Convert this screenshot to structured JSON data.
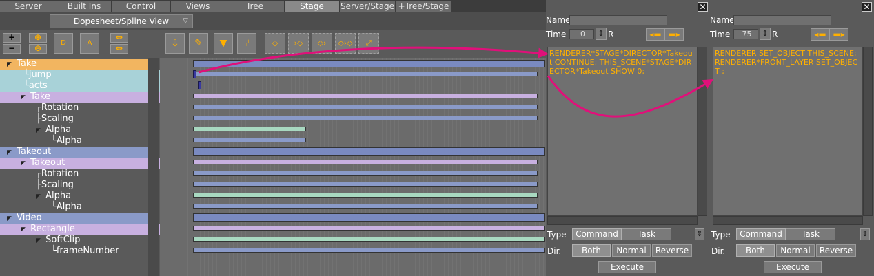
{
  "tabs": [
    "Server",
    "Built Ins",
    "Control",
    "Views",
    "Tree",
    "Stage",
    "Server/Stage",
    "+Tree/Stage"
  ],
  "active_tab": "Stage",
  "view_selector": "Dopesheet/Spline View",
  "toolbar": {
    "zoom_in": "+",
    "zoom_out": "−",
    "zoom_fit": "⊕",
    "zoom_sel": "⊖",
    "folder_d": "D",
    "folder_a": "A"
  },
  "tree": [
    {
      "label": "Take",
      "kind": "director"
    },
    {
      "label": "jump",
      "kind": "child"
    },
    {
      "label": "acts",
      "kind": "child"
    },
    {
      "label": "Take",
      "kind": "actor"
    },
    {
      "label": "Rotation",
      "kind": "channel"
    },
    {
      "label": "Scaling",
      "kind": "channel"
    },
    {
      "label": "Alpha",
      "kind": "group"
    },
    {
      "label": "Alpha",
      "kind": "leaf"
    },
    {
      "label": "Takeout",
      "kind": "director"
    },
    {
      "label": "Takeout",
      "kind": "actor"
    },
    {
      "label": "Rotation",
      "kind": "channel"
    },
    {
      "label": "Scaling",
      "kind": "channel"
    },
    {
      "label": "Alpha",
      "kind": "group"
    },
    {
      "label": "Alpha",
      "kind": "leaf"
    },
    {
      "label": "Video",
      "kind": "director"
    },
    {
      "label": "Rectangle",
      "kind": "actor"
    },
    {
      "label": "SoftClip",
      "kind": "group"
    },
    {
      "label": "frameNumber",
      "kind": "leaf"
    }
  ],
  "panels": [
    {
      "name_label": "Name",
      "name_value": "",
      "time_label": "Time",
      "time_value": "0",
      "r_label": "R",
      "close": "✕",
      "script": "RENDERER*STAGE*DIRECTOR*Takeout CONTINUE;\nTHIS_SCENE*STAGE*DIRECTOR*Takeout SHOW 0;",
      "type_label": "Type",
      "type_command": "Command",
      "type_task": "Task",
      "dir_label": "Dir.",
      "dir_both": "Both",
      "dir_normal": "Normal",
      "dir_reverse": "Reverse",
      "execute": "Execute"
    },
    {
      "name_label": "Name",
      "name_value": "",
      "time_label": "Time",
      "time_value": "75",
      "r_label": "R",
      "close": "✕",
      "script": "RENDERER SET_OBJECT THIS_SCENE;\nRENDERER*FRONT_LAYER SET_OBJECT ;",
      "type_label": "Type",
      "type_command": "Command",
      "type_task": "Task",
      "dir_label": "Dir.",
      "dir_both": "Both",
      "dir_normal": "Normal",
      "dir_reverse": "Reverse",
      "execute": "Execute"
    }
  ],
  "colors": {
    "director": "#f2b560",
    "child": "#a8d2d8",
    "actor": "#c8b0e0",
    "director_blue": "#8a9ac8",
    "accent": "#ffb000",
    "arrow": "#e0107a"
  }
}
